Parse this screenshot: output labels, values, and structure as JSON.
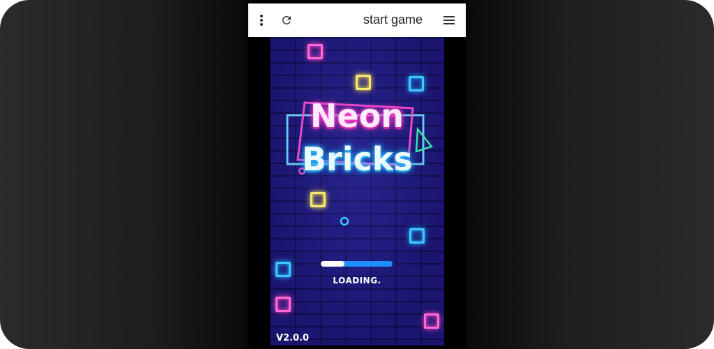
{
  "toolbar": {
    "title": "start game",
    "icons": [
      "more-vert-icon",
      "refresh-icon",
      "hamburger-menu-icon"
    ],
    "background": "#ffffff"
  },
  "game": {
    "logo_word_1": "Neon",
    "logo_word_2": "Bricks",
    "loading_text": "LOADING.",
    "loading_progress": 0.33,
    "version": "V2.0.0",
    "colors": {
      "background": "#1a1670",
      "neon_pink": "#ff3fc8",
      "neon_yellow": "#ffe84a",
      "neon_cyan": "#1fb4ff",
      "loading_bar": "#1f8fff"
    }
  }
}
